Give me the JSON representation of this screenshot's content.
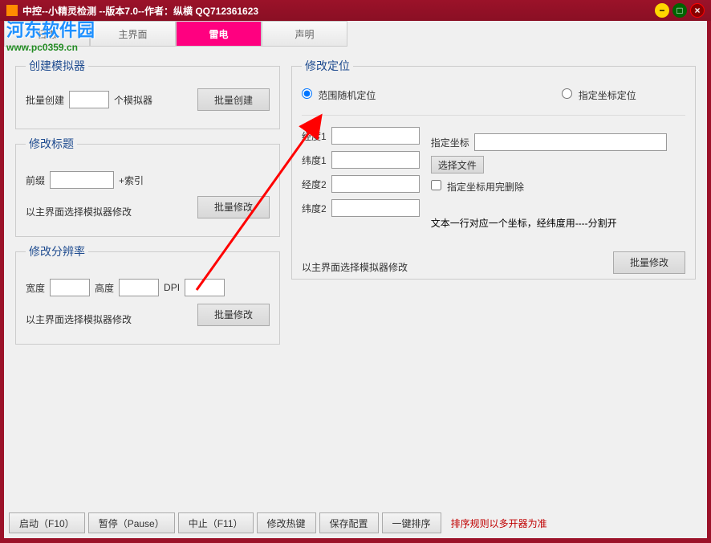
{
  "titlebar": {
    "title": "中控--小精灵检测 --版本7.0--作者：纵横 QQ712361623"
  },
  "watermark": {
    "brand": "河东软件园",
    "url": "www.pc0359.cn"
  },
  "tabs": {
    "log": "日志",
    "main": "主界面",
    "leidian": "雷电",
    "statement": "声明"
  },
  "create_emu": {
    "legend": "创建模拟器",
    "batch_create_label": "批量创建",
    "count_suffix": "个模拟器",
    "batch_create_btn": "批量创建"
  },
  "modify_title": {
    "legend": "修改标题",
    "prefix_label": "前缀",
    "suffix_label": "+索引",
    "hint": "以主界面选择模拟器修改",
    "batch_modify_btn": "批量修改"
  },
  "modify_res": {
    "legend": "修改分辨率",
    "width_label": "宽度",
    "height_label": "高度",
    "dpi_label": "DPI",
    "hint": "以主界面选择模拟器修改",
    "batch_modify_btn": "批量修改"
  },
  "modify_loc": {
    "legend": "修改定位",
    "radio_range": "范围随机定位",
    "radio_fixed": "指定坐标定位",
    "lon1_label": "经度1",
    "lat1_label": "纬度1",
    "lon2_label": "经度2",
    "lat2_label": "纬度2",
    "coord_label": "指定坐标",
    "choose_file_btn": "选择文件",
    "delete_after_use_label": "指定坐标用完删除",
    "note": "文本一行对应一个坐标，经纬度用----分割开",
    "hint": "以主界面选择模拟器修改",
    "batch_modify_btn": "批量修改"
  },
  "bottom": {
    "start": "启动（F10）",
    "pause": "暂停（Pause）",
    "stop": "中止（F11）",
    "hotkey": "修改热键",
    "save": "保存配置",
    "sort": "一键排序",
    "sort_note": "排序规则以多开器为准"
  }
}
